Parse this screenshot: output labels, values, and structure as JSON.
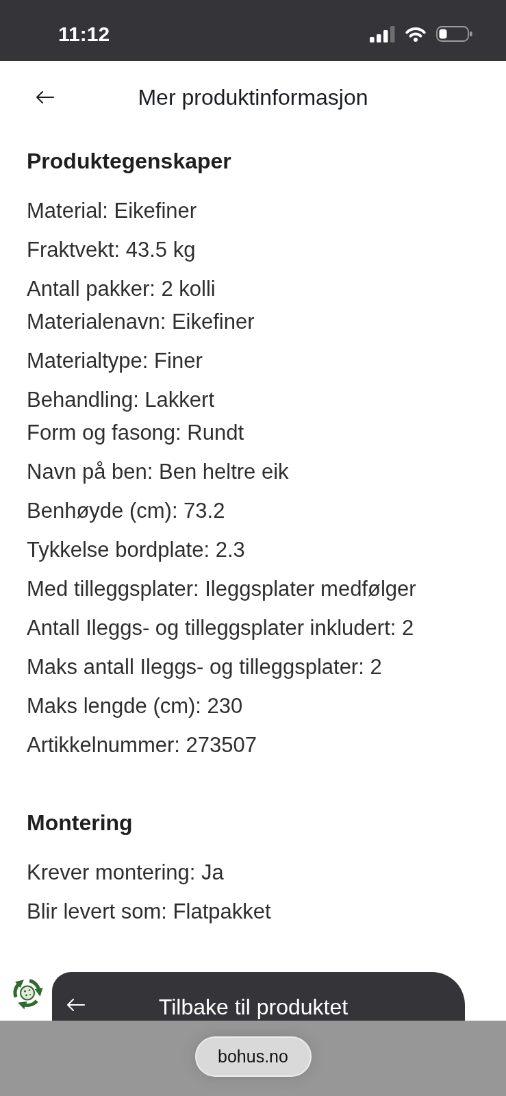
{
  "status_bar": {
    "time": "11:12"
  },
  "header": {
    "title": "Mer produktinformasjon"
  },
  "sections": [
    {
      "heading": "Produktegenskaper",
      "paragraphs": [
        {
          "lines": [
            "Material: Eikefiner"
          ]
        },
        {
          "lines": [
            "Fraktvekt: 43.5 kg"
          ]
        },
        {
          "lines": [
            "Antall pakker: 2 kolli",
            "Materialenavn: Eikefiner"
          ]
        },
        {
          "lines": [
            "Materialtype: Finer"
          ]
        },
        {
          "lines": [
            "Behandling: Lakkert",
            "Form og fasong: Rundt"
          ]
        },
        {
          "lines": [
            "Navn på ben: Ben heltre eik"
          ]
        },
        {
          "lines": [
            "Benhøyde (cm): 73.2"
          ]
        },
        {
          "lines": [
            "Tykkelse bordplate: 2.3"
          ]
        },
        {
          "lines": [
            "Med tilleggsplater: Ileggsplater medfølger"
          ]
        },
        {
          "lines": [
            "Antall Ileggs- og tilleggsplater inkludert: 2"
          ]
        },
        {
          "lines": [
            "Maks antall Ileggs- og tilleggsplater: 2"
          ]
        },
        {
          "lines": [
            "Maks lengde (cm): 230"
          ]
        },
        {
          "lines": [
            "Artikkelnummer: 273507"
          ]
        }
      ]
    },
    {
      "heading": "Montering",
      "paragraphs": [
        {
          "lines": [
            "Krever montering: Ja"
          ]
        },
        {
          "lines": [
            "Blir levert som: Flatpakket"
          ]
        }
      ]
    }
  ],
  "bottom_button": {
    "label": "Tilbake til produktet"
  },
  "browser_bar": {
    "url": "bohus.no"
  }
}
